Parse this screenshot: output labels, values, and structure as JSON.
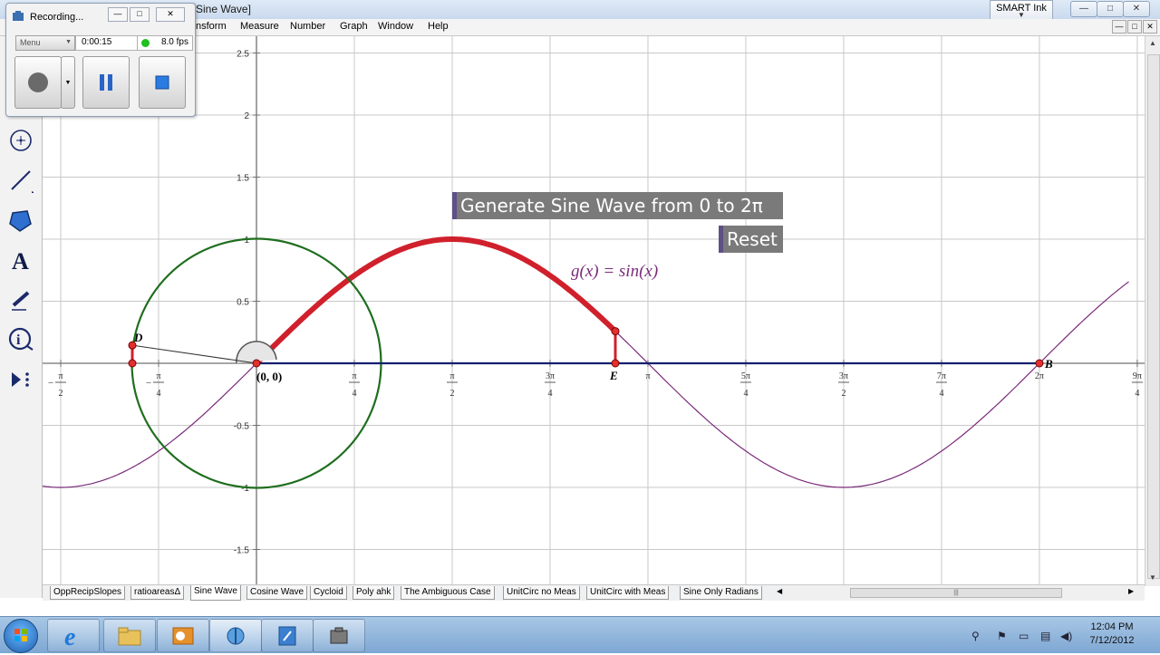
{
  "window": {
    "title_fragment": "Sine Wave]",
    "smart_ink_label": "SMART Ink",
    "minimize_glyph": "—",
    "maximize_glyph": "□",
    "close_glyph": "✕"
  },
  "menubar": {
    "items": [
      "nsform",
      "Measure",
      "Number",
      "Graph",
      "Window",
      "Help"
    ]
  },
  "recorder": {
    "title": "Recording...",
    "menu_label": "Menu",
    "elapsed": "0:00:15",
    "fps": "8.0 fps",
    "status_color": "#1ec11e"
  },
  "toolbox": {
    "tools": [
      "point-tool",
      "compass-tool",
      "straightedge-tool",
      "polygon-tool",
      "text-tool",
      "marker-tool",
      "information-tool",
      "custom-tool"
    ]
  },
  "sketch": {
    "generate_button": "Generate Sine Wave from 0 to 2π",
    "reset_button": "Reset",
    "function_label": "g(x) = sin(x)",
    "origin_label": "(0, 0)",
    "points": {
      "D": "D",
      "E": "E",
      "B": "B"
    },
    "colors": {
      "grid": "#c8c8c8",
      "axis": "#707070",
      "unit_circle": "#1e6e1e",
      "sine_curve": "#7a2a7a",
      "traced_curve": "#d0202c",
      "base_line": "#12206e",
      "button_bg": "#7a7a7a",
      "button_edge": "#5e4f86"
    }
  },
  "chart_data": {
    "type": "line",
    "title": "",
    "function": "g(x) = sin(x)",
    "xlabel": "",
    "ylabel": "",
    "xlim": [
      -2.0,
      7.0
    ],
    "ylim": [
      -1.75,
      2.7
    ],
    "x_ticks": [
      {
        "num": "π",
        "den": "2",
        "sign": "−"
      },
      {
        "num": "π",
        "den": "4",
        "sign": "−"
      },
      {
        "num": "π",
        "den": "4",
        "sign": ""
      },
      {
        "num": "π",
        "den": "2",
        "sign": ""
      },
      {
        "num": "3π",
        "den": "4",
        "sign": ""
      },
      {
        "num": "π",
        "den": "",
        "sign": ""
      },
      {
        "num": "5π",
        "den": "4",
        "sign": ""
      },
      {
        "num": "3π",
        "den": "2",
        "sign": ""
      },
      {
        "num": "7π",
        "den": "4",
        "sign": ""
      },
      {
        "num": "2π",
        "den": "",
        "sign": ""
      },
      {
        "num": "9π",
        "den": "4",
        "sign": ""
      }
    ],
    "y_ticks": [
      "2.5",
      "2",
      "1.5",
      "1",
      "0.5",
      "-0.5",
      "-1",
      "-1.5"
    ],
    "grid": true,
    "series": [
      {
        "name": "g(x) = sin(x)",
        "x_range": [
          -2.0,
          7.0
        ],
        "color": "#7a2a7a"
      },
      {
        "x_range": [
          0.0,
          2.88
        ],
        "color": "#d0202c"
      }
    ]
  },
  "tabs": [
    "OppRecipSlopes",
    "ratioareasΔ",
    "Sine Wave",
    "Cosine Wave",
    "Cycloid",
    "Poly ahk",
    "The Ambiguous Case",
    "UnitCirc no Meas",
    "UnitCirc with Meas",
    "Sine Only Radians"
  ],
  "active_tab": "Sine Wave",
  "taskbar": {
    "time": "12:04 PM",
    "date": "7/12/2012",
    "apps": [
      "internet-explorer",
      "file-explorer",
      "outlook",
      "geometers-sketchpad",
      "notepad",
      "recorder"
    ]
  }
}
